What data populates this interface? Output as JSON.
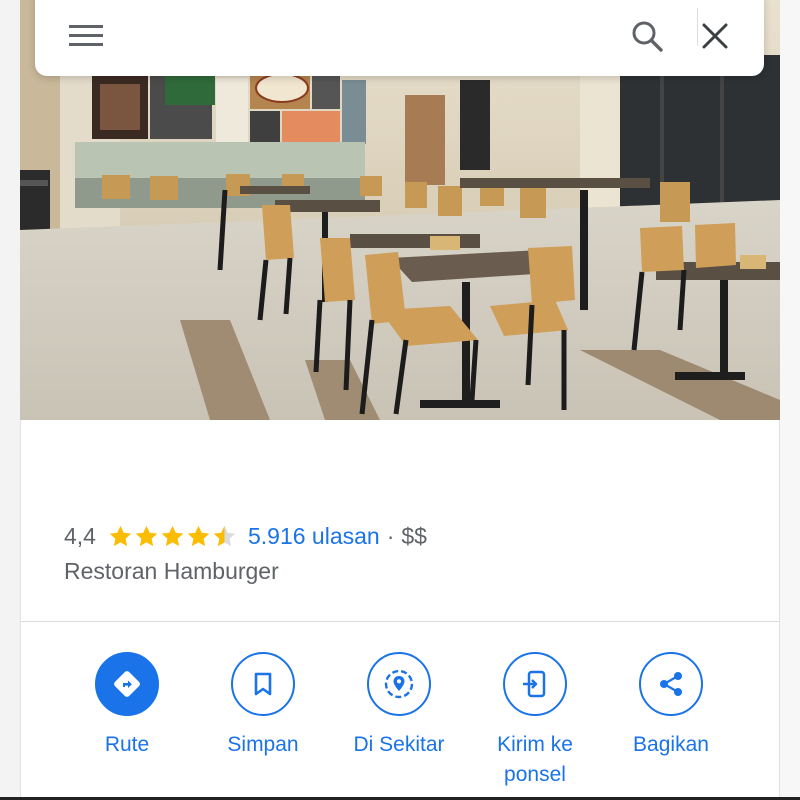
{
  "search": {
    "query": "",
    "placeholder": ""
  },
  "place": {
    "rating": "4,4",
    "stars": 4.5,
    "reviews": "5.916 ulasan",
    "separator": "·",
    "price": "$$",
    "category": "Restoran Hamburger"
  },
  "actions": [
    {
      "label": "Rute",
      "icon": "directions-icon"
    },
    {
      "label": "Simpan",
      "icon": "bookmark-icon"
    },
    {
      "label": "Di Sekitar",
      "icon": "nearby-icon"
    },
    {
      "label": "Kirim ke ponsel",
      "icon": "send-to-phone-icon"
    },
    {
      "label": "Bagikan",
      "icon": "share-icon"
    }
  ],
  "colors": {
    "accent": "#1a73e8",
    "star": "#fbbc04",
    "text_secondary": "#5f6368"
  }
}
